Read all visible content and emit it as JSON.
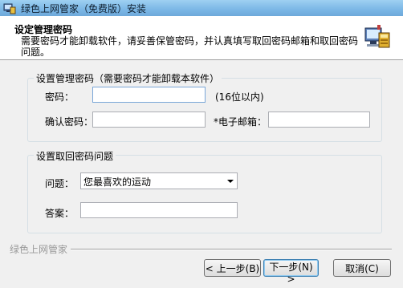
{
  "window": {
    "title": "绿色上网管家（免费版）安装"
  },
  "header": {
    "title": "设定管理密码",
    "description": "需要密码才能卸载软件，请妥善保管密码，并认真填写取回密码邮箱和取回密码问题。"
  },
  "password_group": {
    "title": "设置管理密码（需要密码才能卸载本软件）",
    "password_label": "密码：",
    "password_value": "",
    "password_hint": "(16位以内)",
    "confirm_label": "确认密码：",
    "confirm_value": "",
    "email_label": "*电子邮箱：",
    "email_value": ""
  },
  "recovery_group": {
    "title": "设置取回密码问题",
    "question_label": "问题：",
    "question_value": "您最喜欢的运动",
    "answer_label": "答案：",
    "answer_value": ""
  },
  "footer": {
    "brand": "绿色上网管家",
    "back_label": "< 上一步(B)",
    "next_label": "下一步(N) >",
    "cancel_label": "取消(C)"
  }
}
